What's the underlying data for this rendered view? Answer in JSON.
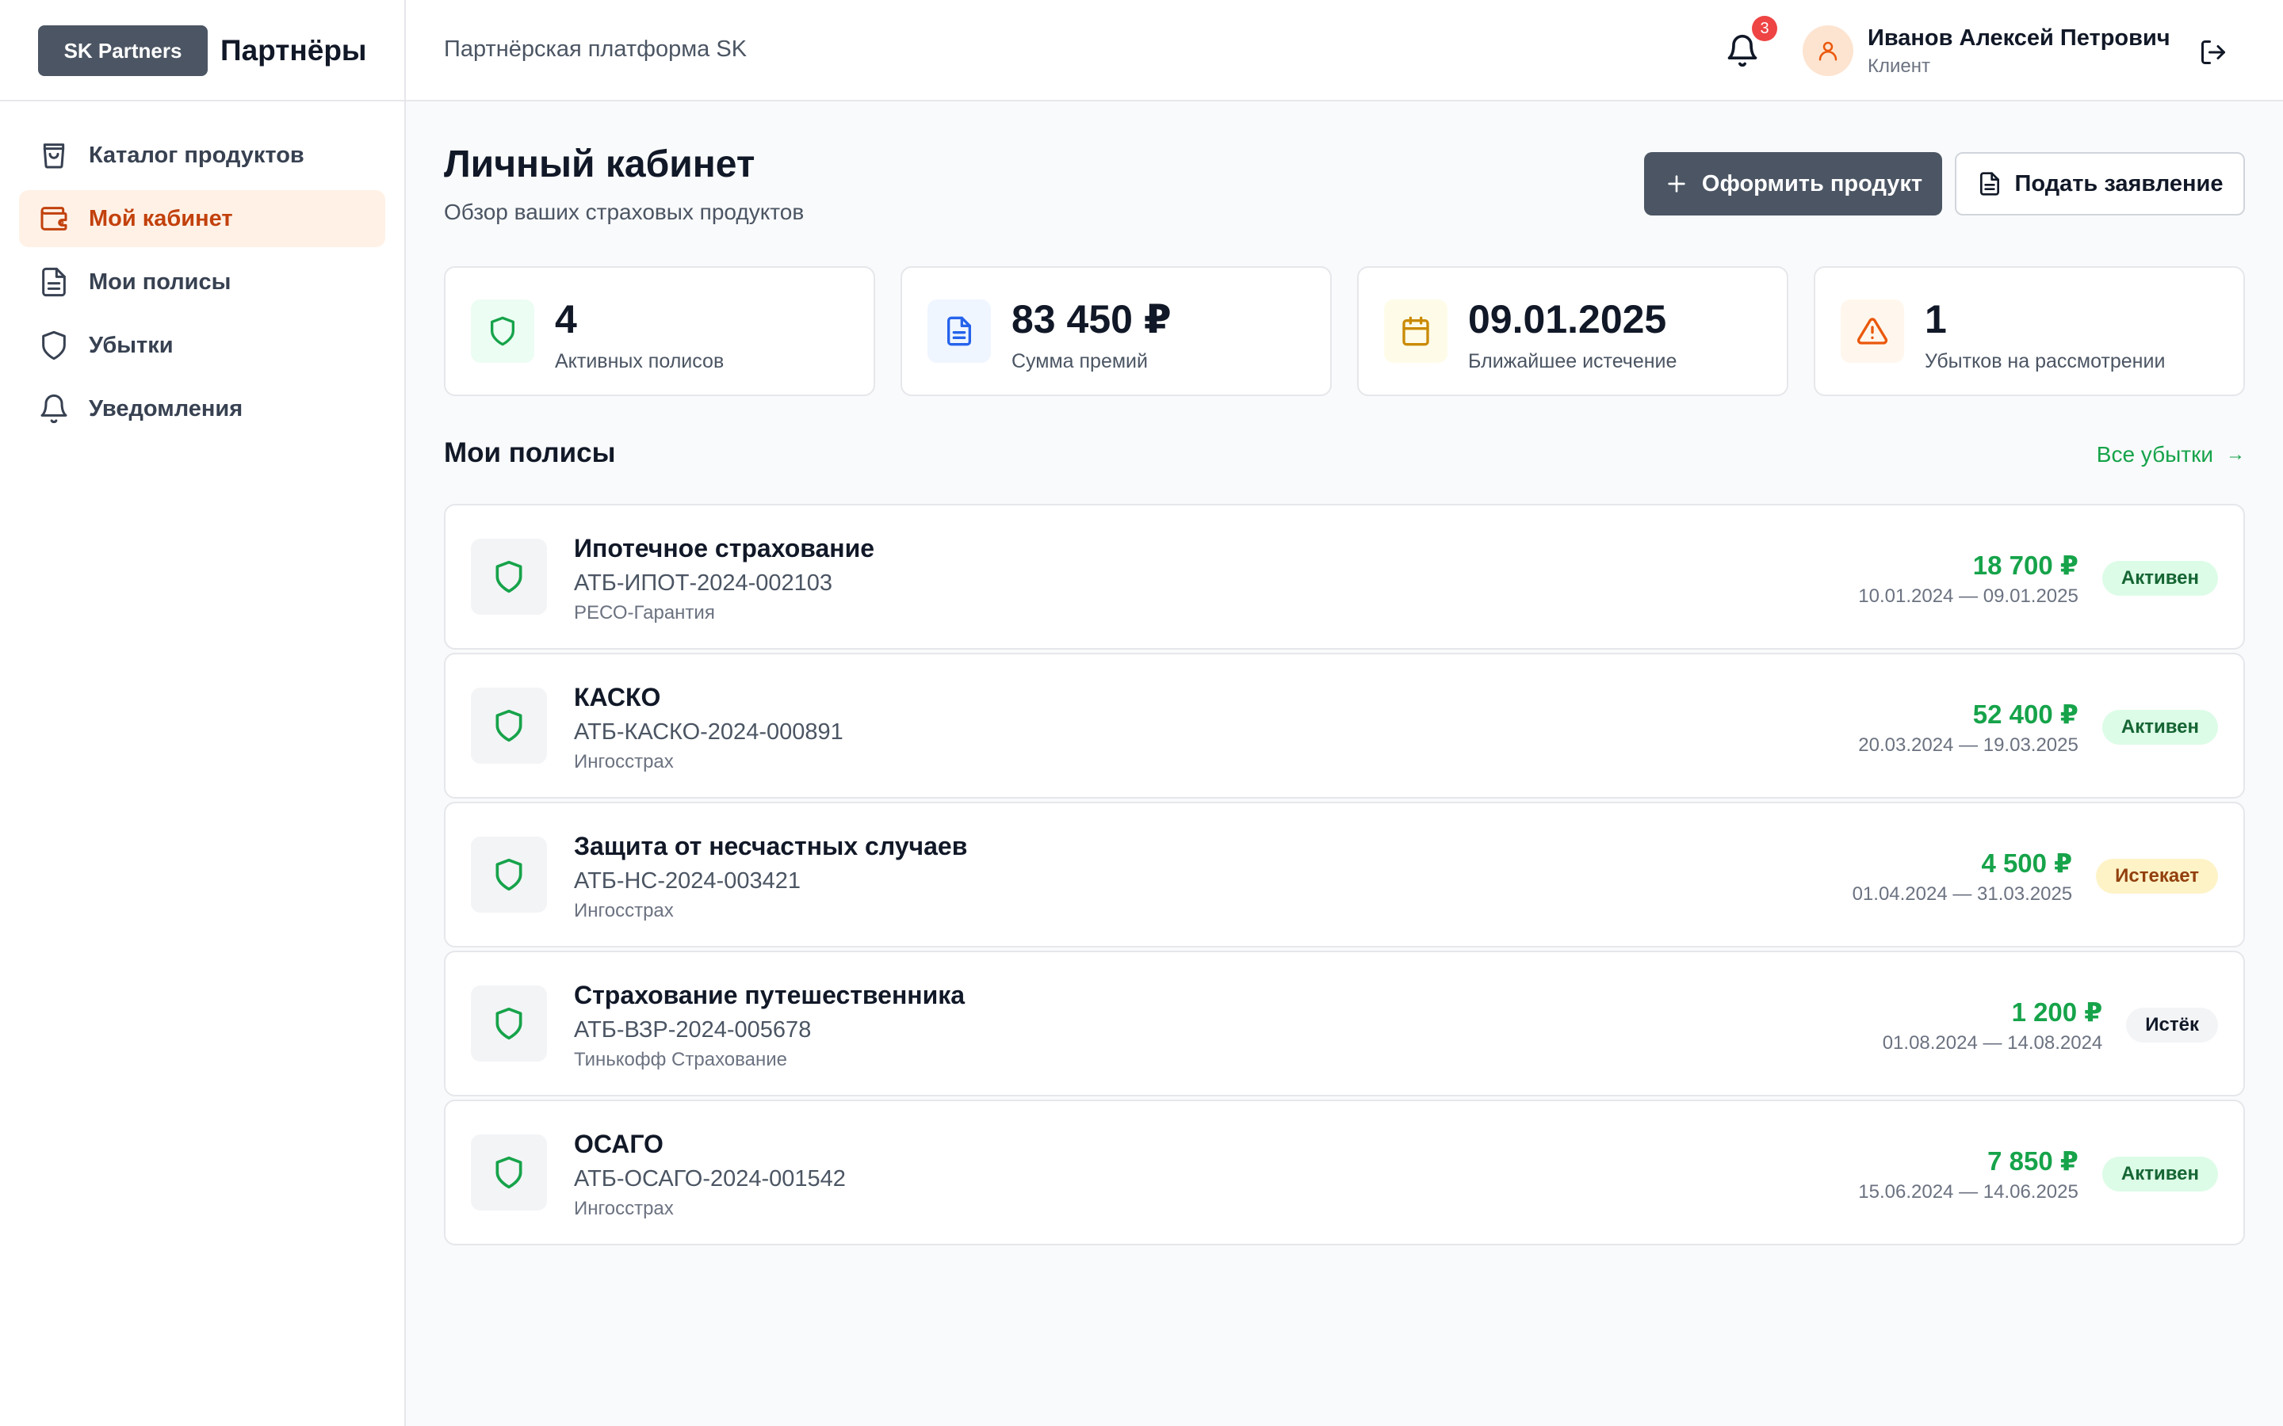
{
  "header": {
    "logo": "SK Partners",
    "brand": "Партнёры",
    "subtitle": "Партнёрская платформа SK",
    "notifications_count": "3",
    "user_name": "Иванов Алексей Петрович",
    "user_role": "Клиент"
  },
  "sidebar": {
    "items": [
      {
        "label": "Каталог продуктов",
        "icon": "shopping-bag-icon",
        "active": false
      },
      {
        "label": "Мой кабинет",
        "icon": "wallet-icon",
        "active": true
      },
      {
        "label": "Мои полисы",
        "icon": "document-icon",
        "active": false
      },
      {
        "label": "Убытки",
        "icon": "shield-icon",
        "active": false
      },
      {
        "label": "Уведомления",
        "icon": "bell-icon",
        "active": false
      }
    ]
  },
  "page": {
    "title": "Личный кабинет",
    "subtitle": "Обзор ваших страховых продуктов",
    "primary_button": "Оформить продукт",
    "secondary_button": "Подать заявление"
  },
  "stats": [
    {
      "value": "4",
      "label": "Активных полисов",
      "icon": "shield-icon",
      "color": "#16a34a",
      "bg": "#ecfdf3"
    },
    {
      "value": "83 450 ₽",
      "label": "Сумма премий",
      "icon": "document-icon",
      "color": "#2563eb",
      "bg": "#eff6ff"
    },
    {
      "value": "09.01.2025",
      "label": "Ближайшее истечение",
      "icon": "calendar-icon",
      "color": "#ca8a04",
      "bg": "#fefce8"
    },
    {
      "value": "1",
      "label": "Убытков на рассмотрении",
      "icon": "warning-icon",
      "color": "#ea580c",
      "bg": "#fff7ed"
    }
  ],
  "policies_section": {
    "title": "Мои полисы",
    "link": "Все убытки"
  },
  "policies": [
    {
      "name": "Ипотечное страхование",
      "number": "АТБ-ИПОТ-2024-002103",
      "insurer": "РЕСО-Гарантия",
      "price": "18 700 ₽",
      "dates": "10.01.2024 — 09.01.2025",
      "status": "Активен",
      "status_type": "active"
    },
    {
      "name": "КАСКО",
      "number": "АТБ-КАСКО-2024-000891",
      "insurer": "Ингосстрах",
      "price": "52 400 ₽",
      "dates": "20.03.2024 — 19.03.2025",
      "status": "Активен",
      "status_type": "active"
    },
    {
      "name": "Защита от несчастных случаев",
      "number": "АТБ-НС-2024-003421",
      "insurer": "Ингосстрах",
      "price": "4 500 ₽",
      "dates": "01.04.2024 — 31.03.2025",
      "status": "Истекает",
      "status_type": "expiring"
    },
    {
      "name": "Страхование путешественника",
      "number": "АТБ-ВЗР-2024-005678",
      "insurer": "Тинькофф Страхование",
      "price": "1 200 ₽",
      "dates": "01.08.2024 — 14.08.2024",
      "status": "Истёк",
      "status_type": "expired"
    },
    {
      "name": "ОСАГО",
      "number": "АТБ-ОСАГО-2024-001542",
      "insurer": "Ингосстрах",
      "price": "7 850 ₽",
      "dates": "15.06.2024 — 14.06.2025",
      "status": "Активен",
      "status_type": "active"
    }
  ]
}
